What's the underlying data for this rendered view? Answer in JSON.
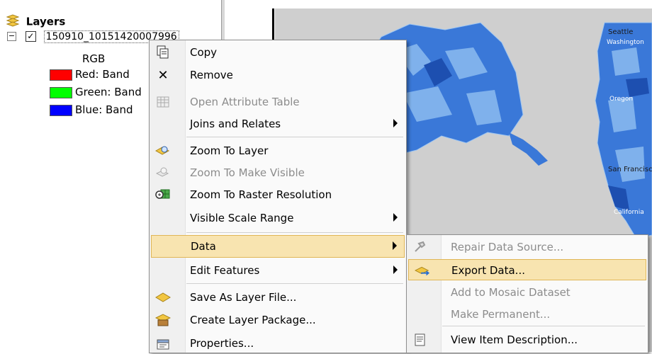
{
  "toc": {
    "title": "Layers",
    "layer_name": "150910_10151420007996",
    "layer_checked": true,
    "rgb_label": "RGB",
    "bands": [
      {
        "label": "Red:  Band",
        "color": "#ff0000"
      },
      {
        "label": "Green: Band",
        "color": "#00ff00"
      },
      {
        "label": "Blue:  Band",
        "color": "#0000ff"
      }
    ]
  },
  "map": {
    "labels": [
      "Seattle",
      "Washington",
      "Oregon",
      "San Francisco",
      "California"
    ]
  },
  "context_menu": {
    "items": [
      {
        "label": "Copy",
        "icon": "copy-icon",
        "enabled": true,
        "submenu": false
      },
      {
        "label": "Remove",
        "icon": "remove-icon",
        "enabled": true,
        "submenu": false
      },
      {
        "label": "Open Attribute Table",
        "icon": "table-icon",
        "enabled": false,
        "submenu": false
      },
      {
        "label": "Joins and Relates",
        "icon": "",
        "enabled": true,
        "submenu": true
      },
      {
        "label": "Zoom To Layer",
        "icon": "zoom-layer-icon",
        "enabled": true,
        "submenu": false
      },
      {
        "label": "Zoom To Make Visible",
        "icon": "zoom-visible-icon",
        "enabled": false,
        "submenu": false
      },
      {
        "label": "Zoom To Raster Resolution",
        "icon": "zoom-raster-icon",
        "enabled": true,
        "submenu": false
      },
      {
        "label": "Visible Scale Range",
        "icon": "",
        "enabled": true,
        "submenu": true
      },
      {
        "label": "Data",
        "icon": "",
        "enabled": true,
        "submenu": true,
        "highlighted": true
      },
      {
        "label": "Edit Features",
        "icon": "",
        "enabled": true,
        "submenu": true
      },
      {
        "label": "Save As Layer File...",
        "icon": "layer-file-icon",
        "enabled": true,
        "submenu": false
      },
      {
        "label": "Create Layer Package...",
        "icon": "layer-package-icon",
        "enabled": true,
        "submenu": false
      },
      {
        "label": "Properties...",
        "icon": "properties-icon",
        "enabled": true,
        "submenu": false
      }
    ]
  },
  "data_submenu": {
    "items": [
      {
        "label": "Repair Data Source...",
        "icon": "repair-icon",
        "enabled": false
      },
      {
        "label": "Export Data...",
        "icon": "export-icon",
        "enabled": true,
        "highlighted": true
      },
      {
        "label": "Add to Mosaic Dataset",
        "icon": "",
        "enabled": false
      },
      {
        "label": "Make Permanent...",
        "icon": "",
        "enabled": false
      },
      {
        "label": "View Item Description...",
        "icon": "item-description-icon",
        "enabled": true
      }
    ]
  },
  "colors": {
    "highlight_bg": "#f8e4b0",
    "highlight_border": "#e0b656",
    "map_blue": "#3a78d8"
  }
}
